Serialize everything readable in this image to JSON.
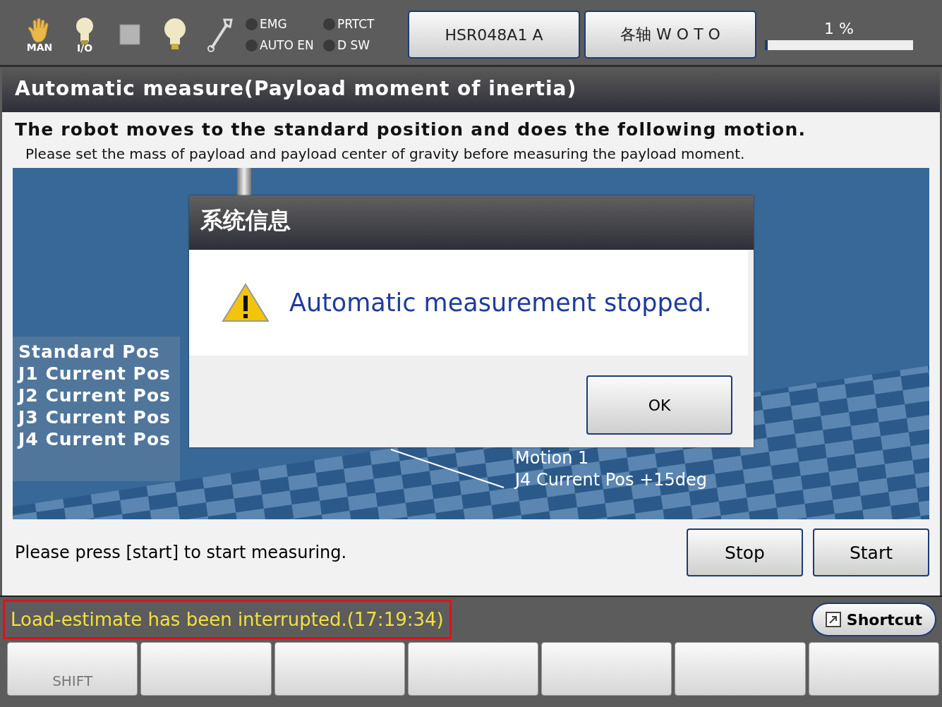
{
  "top_bar": {
    "icons": [
      {
        "kind": "hand",
        "label": "MAN"
      },
      {
        "kind": "bulb-small",
        "label": "I/O"
      },
      {
        "kind": "square"
      },
      {
        "kind": "bulb"
      },
      {
        "kind": "wrench"
      }
    ],
    "indicators": [
      {
        "label": "EMG",
        "on": false
      },
      {
        "label": "PRTCT",
        "on": false
      },
      {
        "label": "AUTO EN",
        "on": false
      },
      {
        "label": "D SW",
        "on": false
      }
    ],
    "robot_button": "HSR048A1 A",
    "mode_button": "各轴 W O T O",
    "speed": {
      "text": "1 %",
      "level": 0.01
    }
  },
  "title": "Automatic measure(Payload moment of inertia)",
  "heading": "The robot moves to the standard position and does the following motion.",
  "note": "Please set the mass of payload and payload center of gravity before measuring the payload moment.",
  "viewport": {
    "labels": [
      "Standard Pos",
      "J1 Current Pos",
      "J2 Current Pos",
      "J3 Current Pos",
      "J4 Current Pos"
    ],
    "motion_labels": [
      "Motion 1",
      "J4 Current Pos +15deg"
    ]
  },
  "dialog": {
    "title": "系统信息",
    "message": "Automatic measurement stopped.",
    "button": "OK"
  },
  "prompt": "Please press [start] to start measuring.",
  "buttons": [
    "Stop",
    "Start"
  ],
  "status": {
    "message": "Load-estimate has been interrupted.(17:19:34)",
    "shortcut": "Shortcut"
  },
  "function_keys": [
    {
      "kind": "labeled",
      "label": "SHIFT"
    },
    {
      "kind": "blank"
    },
    {
      "kind": "blank"
    },
    {
      "kind": "blank"
    },
    {
      "kind": "blank"
    },
    {
      "kind": "blank"
    },
    {
      "kind": "blank"
    }
  ]
}
